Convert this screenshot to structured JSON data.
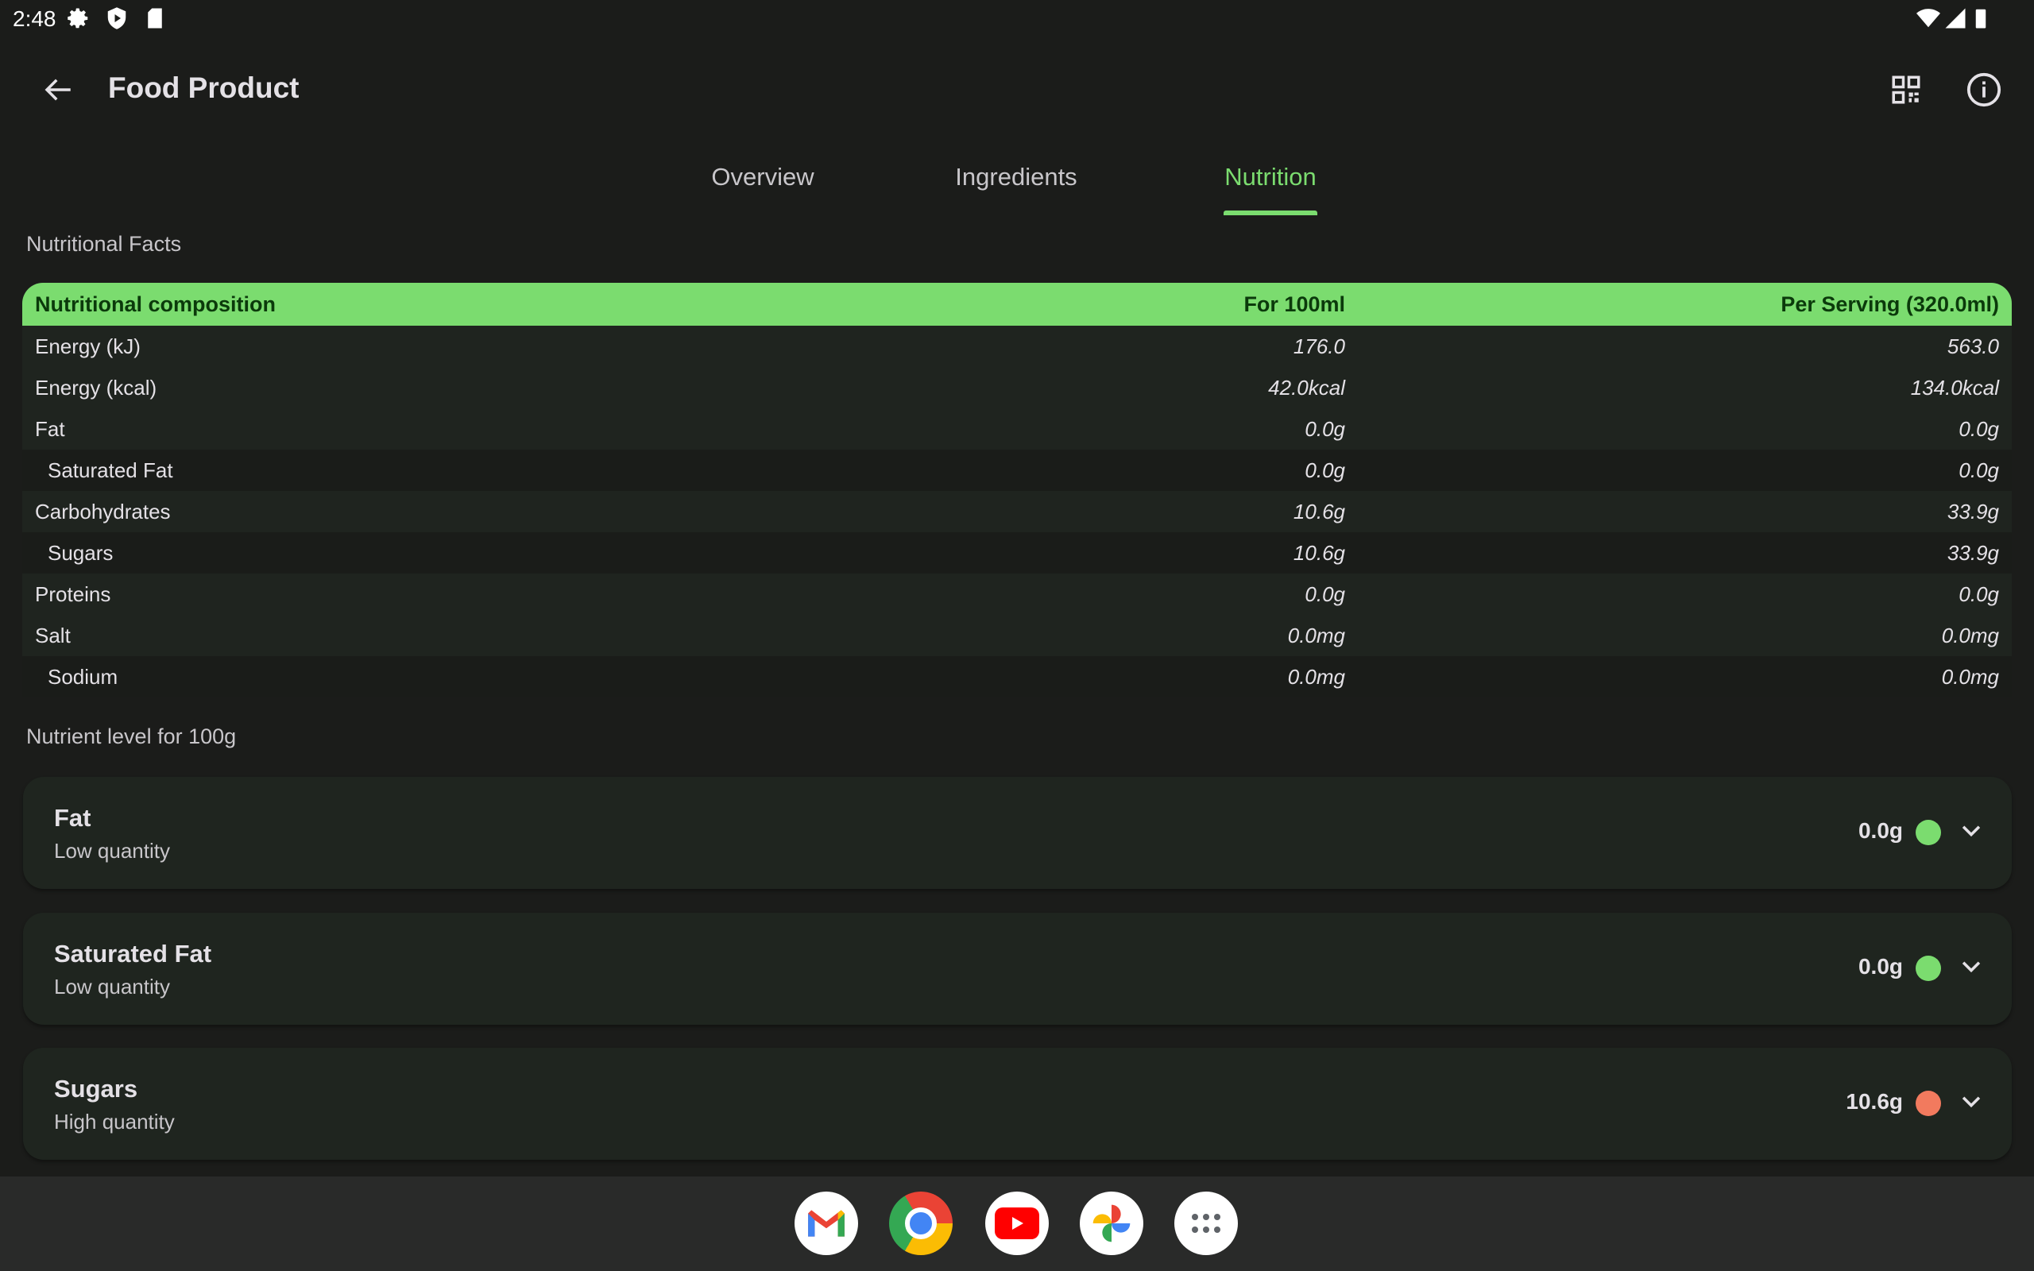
{
  "status_bar": {
    "time": "2:48"
  },
  "top_bar": {
    "title": "Food Product"
  },
  "tabs": [
    {
      "label": "Overview"
    },
    {
      "label": "Ingredients"
    },
    {
      "label": "Nutrition"
    }
  ],
  "active_tab": "Nutrition",
  "facts": {
    "section_title": "Nutritional Facts",
    "headers": [
      "Nutritional composition",
      "For 100ml",
      "Per Serving (320.0ml)"
    ],
    "rows": [
      {
        "name": "Energy (kJ)",
        "per100": "176.0",
        "serving": "563.0"
      },
      {
        "name": "Energy (kcal)",
        "per100": "42.0kcal",
        "serving": "134.0kcal"
      },
      {
        "name": "Fat",
        "per100": "0.0g",
        "serving": "0.0g"
      },
      {
        "name": "Saturated Fat",
        "per100": "0.0g",
        "serving": "0.0g"
      },
      {
        "name": "Carbohydrates",
        "per100": "10.6g",
        "serving": "33.9g"
      },
      {
        "name": "Sugars",
        "per100": "10.6g",
        "serving": "33.9g"
      },
      {
        "name": "Proteins",
        "per100": "0.0g",
        "serving": "0.0g"
      },
      {
        "name": "Salt",
        "per100": "0.0mg",
        "serving": "0.0mg"
      },
      {
        "name": "Sodium",
        "per100": "0.0mg",
        "serving": "0.0mg"
      }
    ]
  },
  "levels": {
    "section_title": "Nutrient level for 100g",
    "items": [
      {
        "name": "Fat",
        "level": "Low quantity",
        "value": "0.0g",
        "color": "#7bdc6f"
      },
      {
        "name": "Saturated Fat",
        "level": "Low quantity",
        "value": "0.0g",
        "color": "#7bdc6f"
      },
      {
        "name": "Sugars",
        "level": "High quantity",
        "value": "10.6g",
        "color": "#f27a5e"
      }
    ]
  },
  "colors": {
    "accent": "#7bdc6f",
    "background": "#1b1c1a"
  },
  "dock": [
    "gmail-icon",
    "chrome-icon",
    "youtube-icon",
    "photos-icon",
    "app-drawer-icon"
  ]
}
